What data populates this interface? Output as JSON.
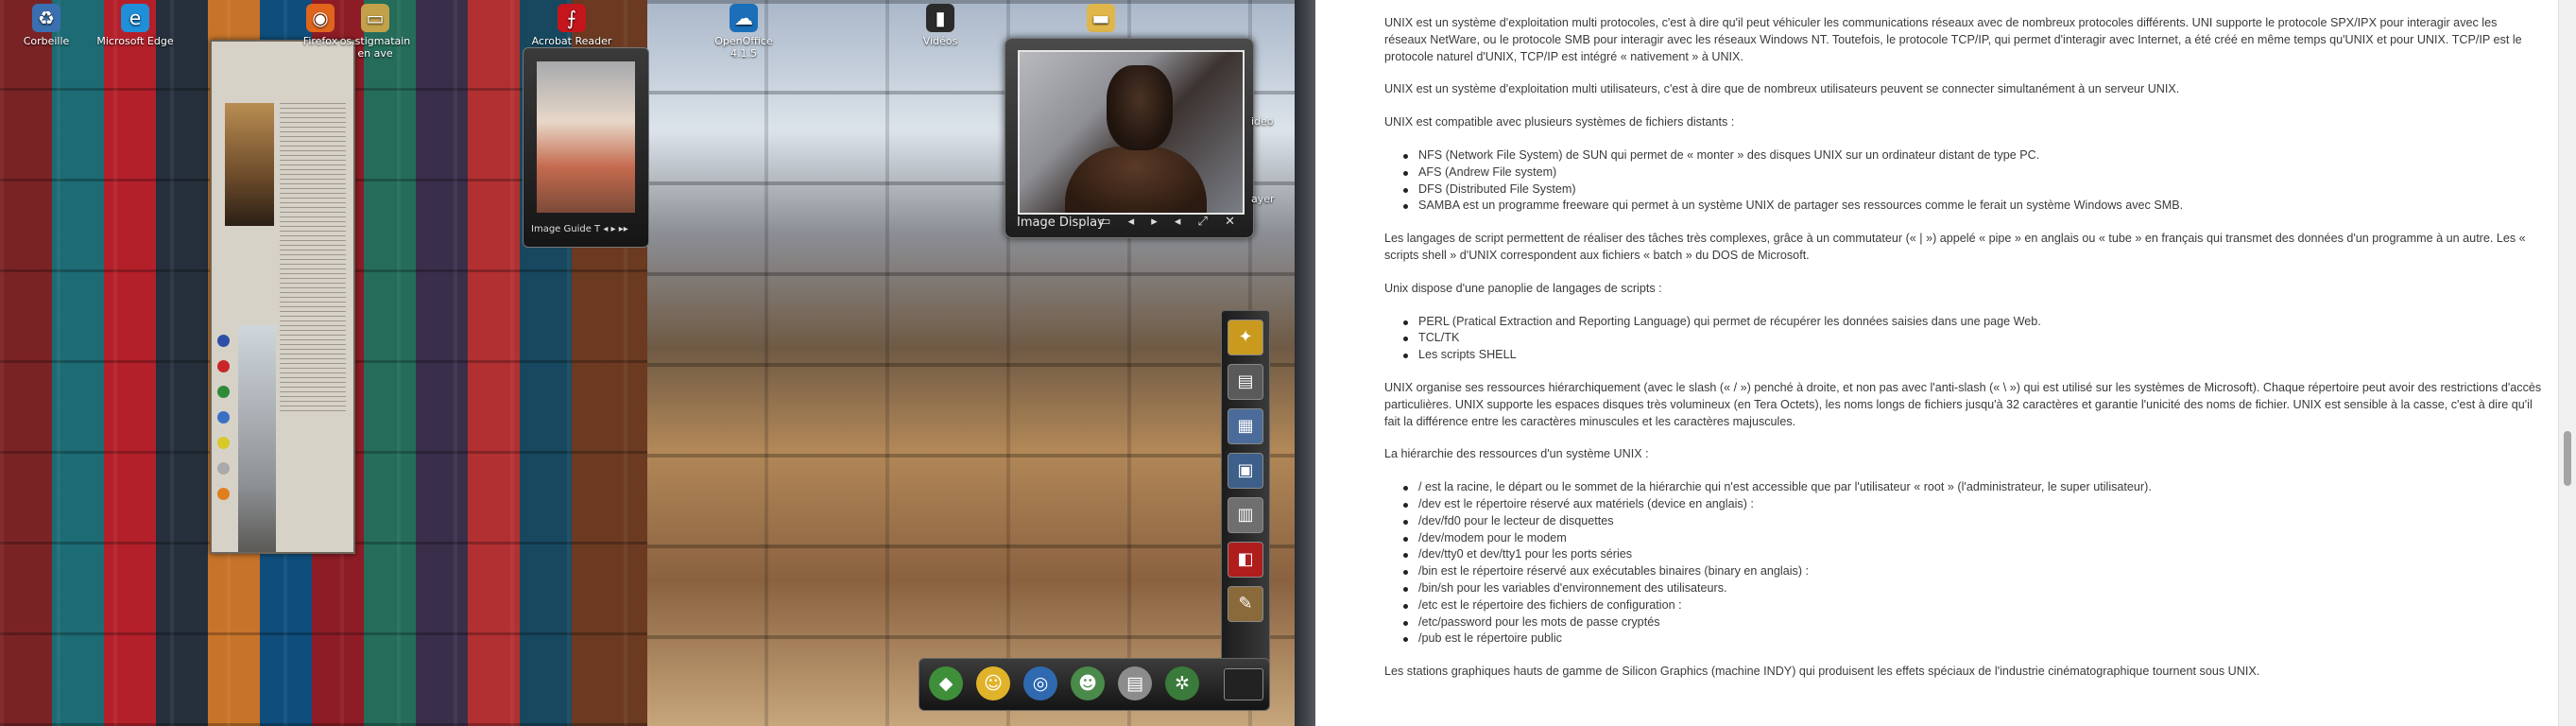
{
  "desktop": {
    "icons": [
      {
        "label": "Corbeille",
        "icon": "recycle-bin-icon",
        "glyph": "♻",
        "color": "#3a6fb0"
      },
      {
        "label": "Microsoft Edge",
        "icon": "edge-browser-icon",
        "glyph": "e",
        "color": "#1f8fd8"
      },
      {
        "label": "Firefox",
        "icon": "firefox-icon",
        "glyph": "◉",
        "color": "#e0641b"
      },
      {
        "label": "os.stigmatain en ave",
        "icon": "folder-icon",
        "glyph": "▭",
        "color": "#c2a14a"
      },
      {
        "label": "Acrobat Reader DC",
        "icon": "acrobat-reader-icon",
        "glyph": "⨍",
        "color": "#c4161c"
      },
      {
        "label": "OpenOffice 4.1.5",
        "icon": "openoffice-icon",
        "glyph": "☁",
        "color": "#1a6fb8"
      },
      {
        "label": "Vidéos",
        "icon": "videos-folder-icon",
        "glyph": "▮",
        "color": "#2b2b2b"
      },
      {
        "label": "",
        "icon": "folder-icon",
        "glyph": "▬",
        "color": "#e0b64a"
      }
    ],
    "side_labels": [
      "ideo",
      "ayer"
    ]
  },
  "small_gadget": {
    "caption": "Image Guide    T ◂ ▸ ▸▸"
  },
  "image_display": {
    "title": "Image Display",
    "controls": "▭ ◂ ▸ ◂ ⤢ ✕"
  },
  "side_dock": {
    "items": [
      {
        "icon": "creative-park-icon",
        "glyph": "✦",
        "color": "#c99a1e"
      },
      {
        "icon": "toolbox-icon",
        "glyph": "▤",
        "color": "#5a5a5a"
      },
      {
        "icon": "photo-album-icon",
        "glyph": "▦",
        "color": "#4b6c9a"
      },
      {
        "icon": "image-viewer-icon",
        "glyph": "▣",
        "color": "#3d5f8a"
      },
      {
        "icon": "calendar-photos-icon",
        "glyph": "▥",
        "color": "#6f6f6f"
      },
      {
        "icon": "red-book-icon",
        "glyph": "◧",
        "color": "#b01d1d"
      },
      {
        "icon": "photo-editor-icon",
        "glyph": "✎",
        "color": "#8a6a3a"
      }
    ]
  },
  "bottom_dock": {
    "items": [
      {
        "icon": "green-chart-icon",
        "glyph": "◆",
        "color": "#3f8f3a"
      },
      {
        "icon": "smiley-mascot-icon",
        "glyph": "☺",
        "color": "#e0b32a"
      },
      {
        "icon": "globe-network-icon",
        "glyph": "◎",
        "color": "#2f6ab0"
      },
      {
        "icon": "people-icon",
        "glyph": "☻",
        "color": "#4a8a4a"
      },
      {
        "icon": "documents-icon",
        "glyph": "▤",
        "color": "#8c8c8c"
      },
      {
        "icon": "settings-icon",
        "glyph": "✲",
        "color": "#3a7a3a"
      }
    ]
  },
  "document": {
    "paragraphs": [
      {
        "type": "p",
        "text": "UNIX est un système d'exploitation multi protocoles, c'est à dire qu'il peut véhiculer les communications réseaux avec de nombreux protocoles différents. UNI supporte le protocole SPX/IPX pour interagir avec les réseaux NetWare, ou le protocole SMB pour interagir avec les réseaux Windows NT. Toutefois, le protocole TCP/IP, qui permet d'interagir avec Internet, a été créé en même temps qu'UNIX et pour UNIX. TCP/IP est le protocole naturel d'UNIX, TCP/IP est intégré « nativement » à UNIX."
      },
      {
        "type": "p",
        "text": "UNIX est un système d'exploitation multi utilisateurs, c'est à dire que de nombreux utilisateurs peuvent se connecter simultanément à un serveur UNIX."
      },
      {
        "type": "p",
        "text": "UNIX est compatible avec plusieurs systèmes de fichiers distants :"
      },
      {
        "type": "ul",
        "items": [
          "NFS (Network File System) de SUN qui permet de « monter » des disques UNIX sur un ordinateur distant de type PC.",
          "AFS (Andrew File system)",
          "DFS (Distributed File System)",
          "SAMBA est un programme freeware qui permet à un système UNIX de partager ses ressources comme le ferait un système Windows avec SMB."
        ]
      },
      {
        "type": "p",
        "text": "Les langages de script permettent de réaliser des tâches très complexes, grâce à un commutateur (« | ») appelé « pipe » en anglais ou « tube » en français qui transmet des données d'un programme à un autre. Les « scripts shell » d'UNIX correspondent aux fichiers « batch » du DOS de Microsoft."
      },
      {
        "type": "p",
        "text": "Unix dispose d'une panoplie de langages de scripts :"
      },
      {
        "type": "ul",
        "items": [
          "PERL (Pratical Extraction and Reporting Language) qui permet de récupérer les données saisies dans une page Web.",
          "TCL/TK",
          "Les scripts SHELL"
        ]
      },
      {
        "type": "p",
        "text": "UNIX organise ses ressources hiérarchiquement (avec le slash (« / ») penché à droite, et non pas avec l'anti-slash (« \\ ») qui est utilisé sur les systèmes de Microsoft). Chaque répertoire peut avoir des restrictions d'accès particulières. UNIX supporte les espaces disques très volumineux (en Tera Octets), les noms longs de fichiers jusqu'à 32 caractères et garantie l'unicité des noms de fichier. UNIX est sensible à la casse, c'est à dire qu'il fait la différence entre les caractères minuscules et les caractères majuscules."
      },
      {
        "type": "p",
        "text": "La hiérarchie des ressources d'un système UNIX :"
      },
      {
        "type": "ul",
        "items": [
          "/ est la racine, le départ ou le sommet de la hiérarchie qui n'est accessible que par l'utilisateur « root » (l'administrateur, le super utilisateur).",
          "/dev est le répertoire réservé aux matériels (device en anglais) :",
          "/dev/fd0 pour le lecteur de disquettes",
          "/dev/modem pour le modem",
          "/dev/tty0 et dev/tty1 pour les ports séries",
          "/bin est le répertoire réservé aux exécutables binaires (binary en anglais) :",
          "/bin/sh pour les variables d'environnement des utilisateurs.",
          "/etc est le répertoire des fichiers de configuration :",
          "/etc/password pour les mots de passe cryptés",
          "/pub est le répertoire public"
        ]
      },
      {
        "type": "p",
        "text": "Les stations graphiques hauts de gamme de Silicon Graphics (machine INDY) qui produisent les effets spéciaux de l'industrie cinématographique tournent sous UNIX."
      }
    ]
  }
}
